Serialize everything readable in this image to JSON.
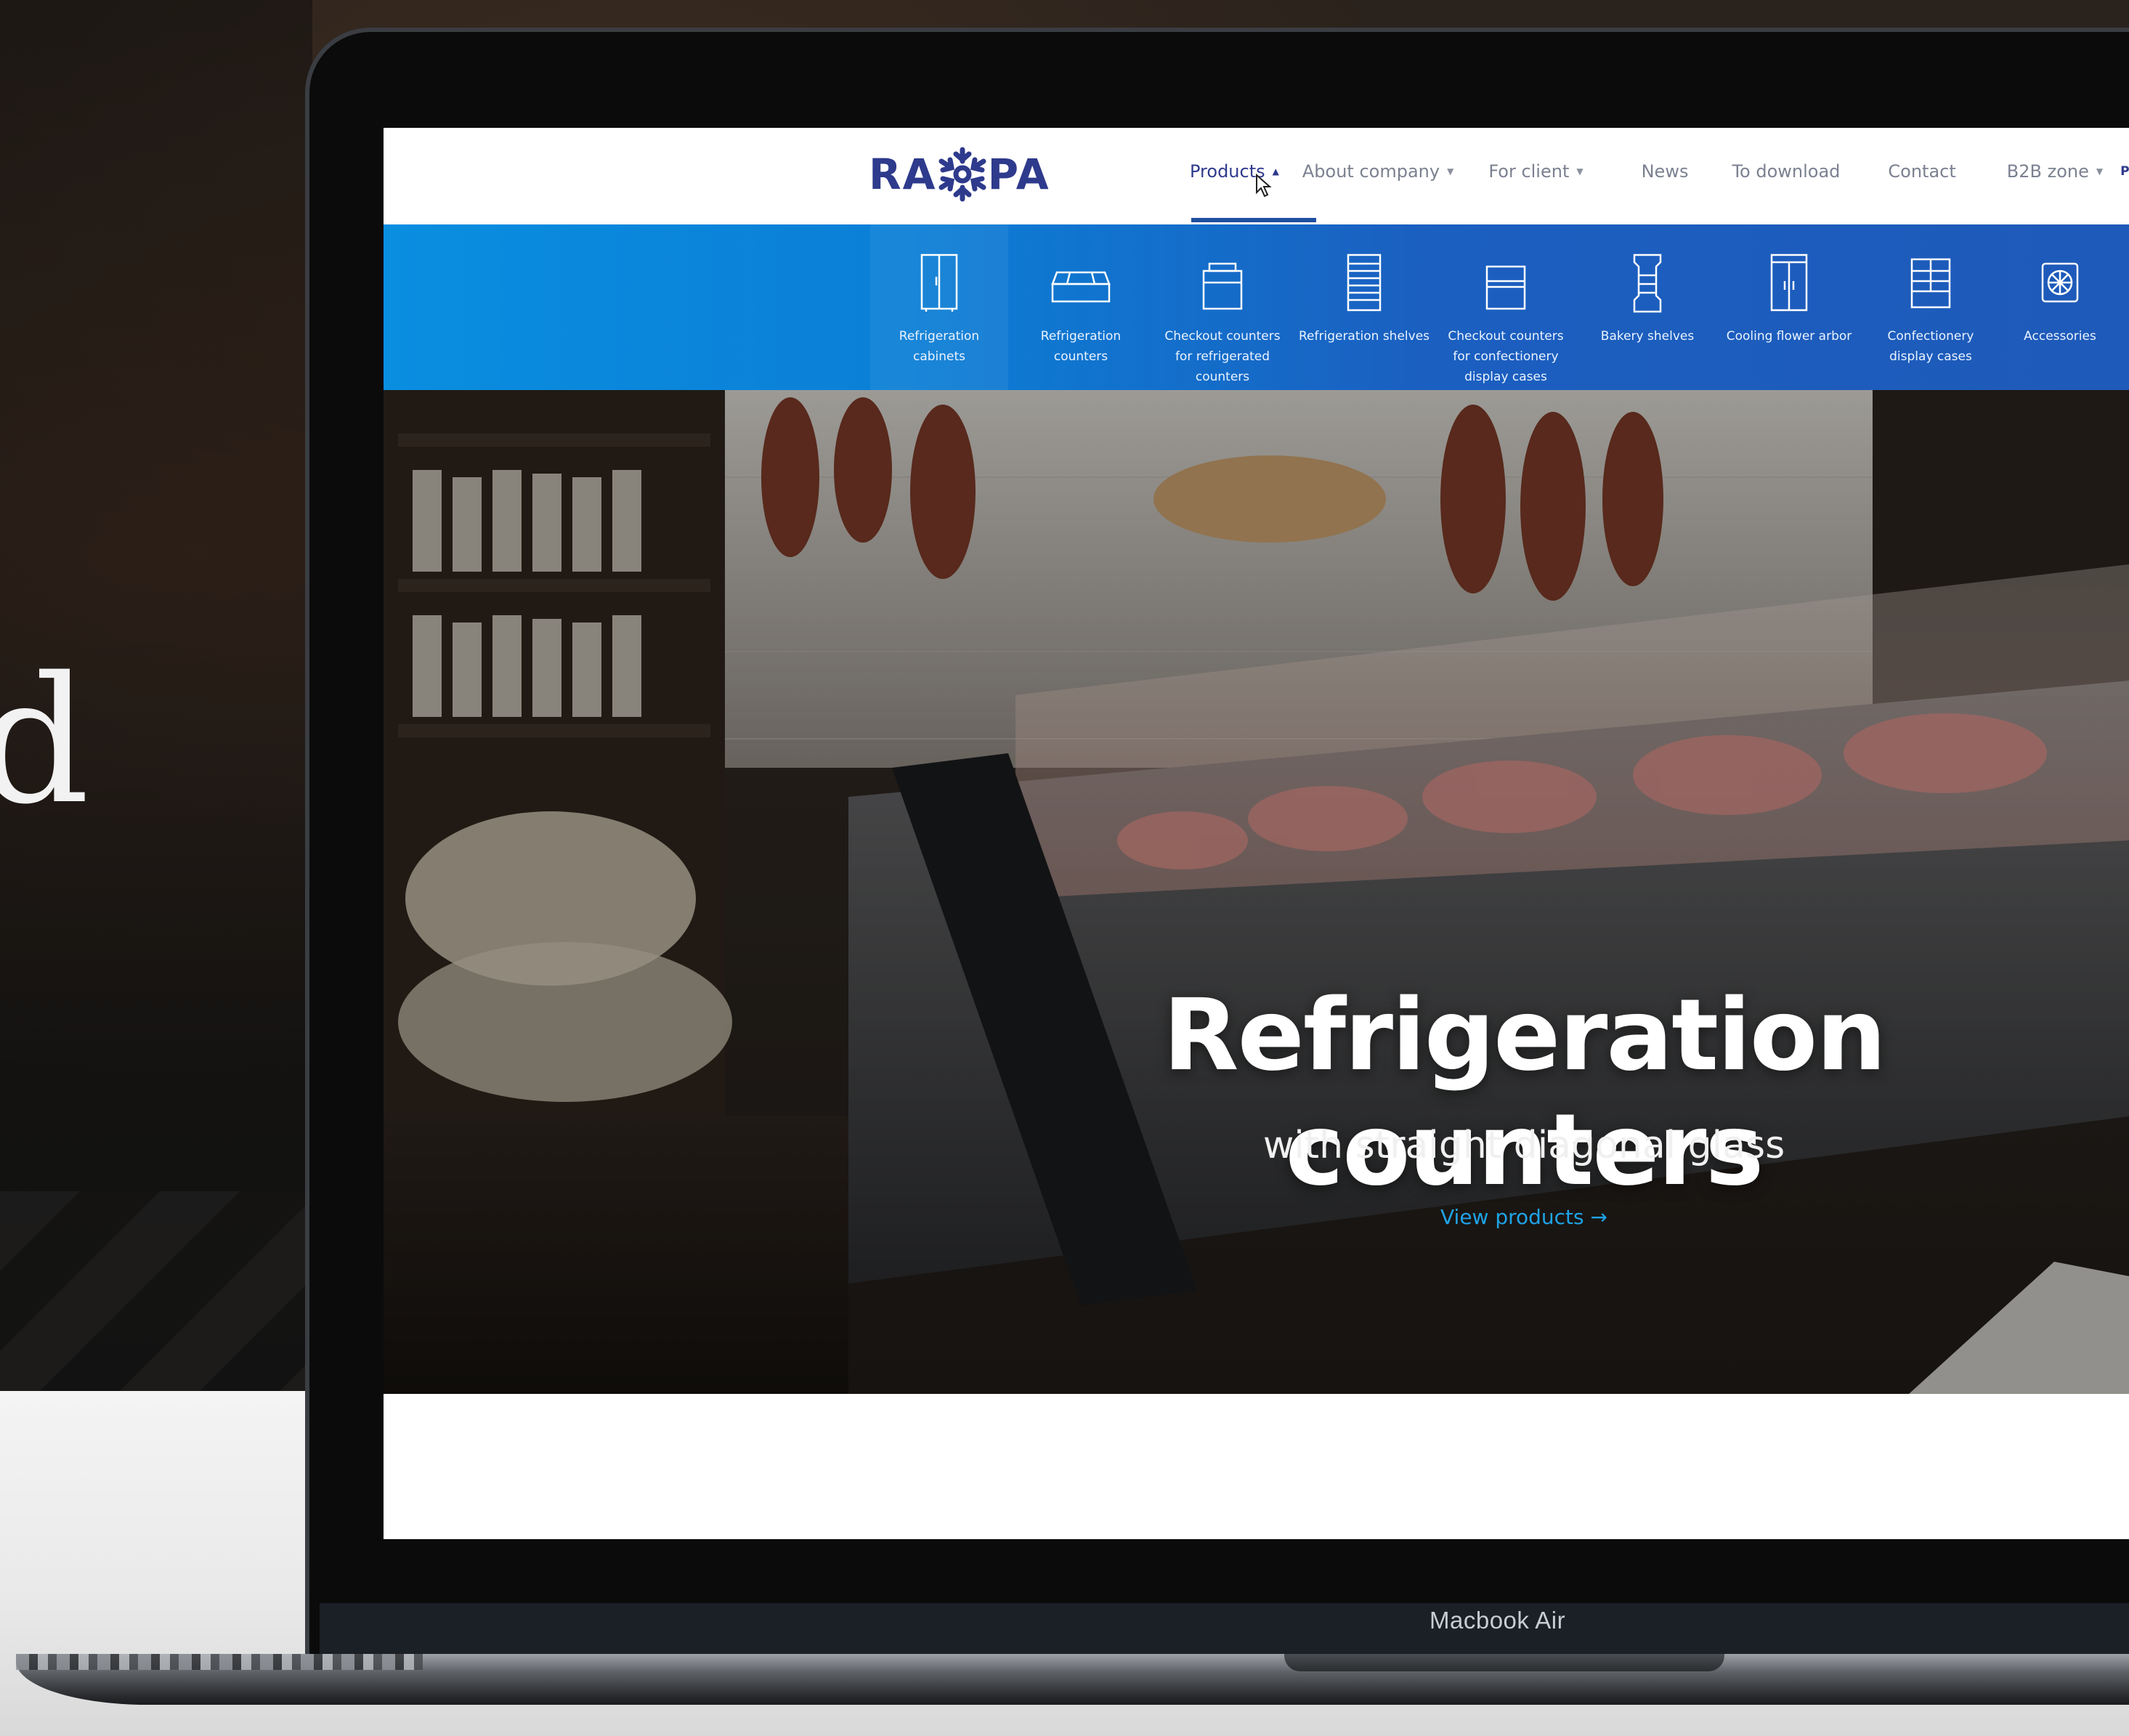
{
  "colors": {
    "brand": "#2e3a8c",
    "nav_text": "#7b8190",
    "mega_menu_blue": "#0b7fd6",
    "link_blue": "#1fa3e6",
    "hero_text": "#ffffff"
  },
  "background": {
    "partial_text": "d"
  },
  "device": {
    "label": "Macbook Air"
  },
  "site": {
    "logo": {
      "left": "RA",
      "right": "PA",
      "icon": "snowflake-logo-icon"
    },
    "nav": [
      {
        "label": "Products",
        "caret": "▲",
        "active": true
      },
      {
        "label": "About company",
        "caret": "▼"
      },
      {
        "label": "For client",
        "caret": "▼"
      },
      {
        "label": "News"
      },
      {
        "label": "To download"
      },
      {
        "label": "Contact"
      },
      {
        "label": "B2B zone",
        "caret": "▼"
      },
      {
        "label": "PL"
      }
    ],
    "mega_menu": [
      {
        "label": "Refrigeration cabinets",
        "icon": "refrigeration-cabinet-icon"
      },
      {
        "label": "Refrigeration counters",
        "icon": "refrigeration-counter-icon"
      },
      {
        "label": "Checkout counters for refrigerated counters",
        "icon": "checkout-counter-icon"
      },
      {
        "label": "Refrigeration shelves",
        "icon": "refrigeration-shelves-icon"
      },
      {
        "label": "Checkout counters for confectionery display cases",
        "icon": "confectionery-checkout-icon"
      },
      {
        "label": "Bakery shelves",
        "icon": "bakery-shelves-icon"
      },
      {
        "label": "Cooling flower arbor",
        "icon": "flower-arbor-icon"
      },
      {
        "label": "Confectionery display cases",
        "icon": "confectionery-display-icon"
      },
      {
        "label": "Accessories",
        "icon": "accessories-icon"
      }
    ],
    "hero": {
      "title": "Refrigeration counters",
      "subtitle": "with straight diagonal glass",
      "link": "View products →"
    }
  }
}
